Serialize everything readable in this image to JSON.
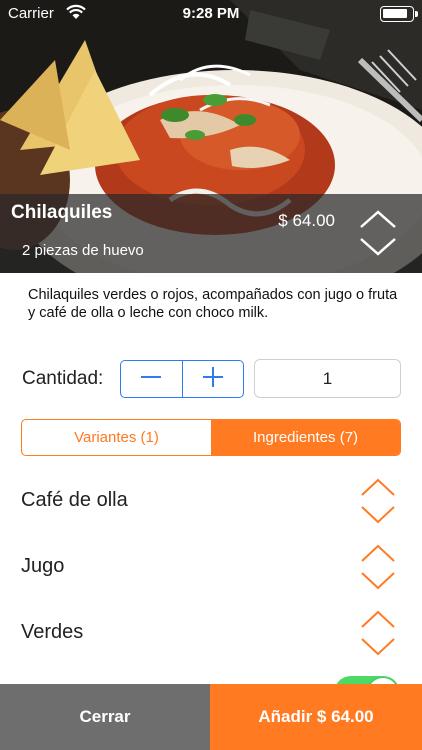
{
  "status_bar": {
    "carrier": "Carrier",
    "time": "9:28 PM"
  },
  "product": {
    "title": "Chilaquiles",
    "subtitle": "2 piezas de huevo",
    "price": "$ 64.00",
    "description": "Chilaquiles verdes o rojos, acompañados con jugo o fruta y café de olla o leche con choco milk."
  },
  "quantity": {
    "label": "Cantidad:",
    "value": "1"
  },
  "tabs": [
    {
      "label": "Variantes (1)",
      "active": false
    },
    {
      "label": "Ingredientes (7)",
      "active": true
    }
  ],
  "ingredients": [
    {
      "label": "Café de olla"
    },
    {
      "label": "Jugo"
    },
    {
      "label": "Verdes"
    }
  ],
  "toggle": {
    "on": true
  },
  "actions": {
    "close_label": "Cerrar",
    "add_label": "Añadir $ 64.00"
  },
  "colors": {
    "accent": "#ff7a21",
    "stepper_blue": "#2f7bf0",
    "close_gray": "#6e6e6e",
    "toggle_green": "#4cd964"
  },
  "icons": [
    "wifi-icon",
    "battery-icon",
    "chevron-up-down-icon",
    "minus-icon",
    "plus-icon"
  ]
}
